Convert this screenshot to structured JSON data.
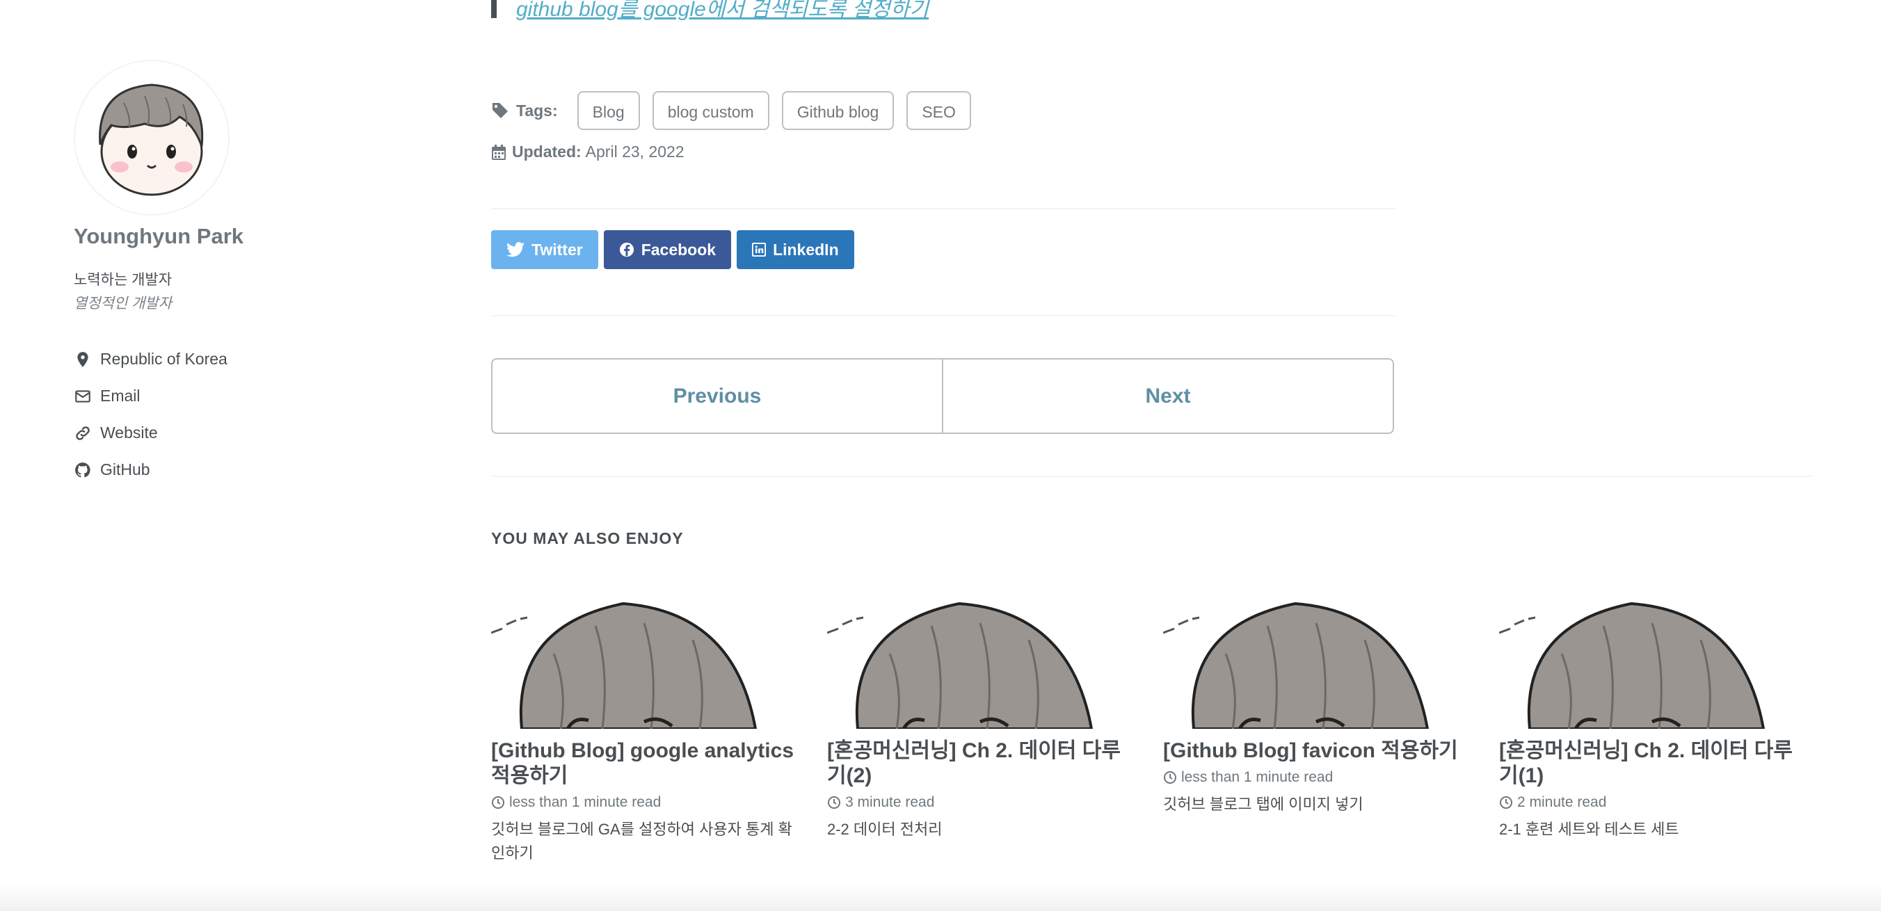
{
  "quote": {
    "link_text": "github blog를 google에서 검색되도록 설정하기"
  },
  "sidebar": {
    "author_name": "Younghyun Park",
    "bio_line1": "노력하는 개발자",
    "bio_line2": "열정적인 개발자",
    "links": [
      {
        "label": "Republic of Korea",
        "icon": "map-marker-icon"
      },
      {
        "label": "Email",
        "icon": "envelope-icon"
      },
      {
        "label": "Website",
        "icon": "link-icon"
      },
      {
        "label": "GitHub",
        "icon": "github-icon"
      }
    ]
  },
  "meta": {
    "tags_label": "Tags:",
    "tags": [
      "Blog",
      "blog custom",
      "Github blog",
      "SEO"
    ],
    "updated_label": "Updated:",
    "updated_value": "April 23, 2022"
  },
  "share": {
    "twitter": "Twitter",
    "facebook": "Facebook",
    "linkedin": "LinkedIn",
    "colors": {
      "twitter": "#6bb3ee",
      "facebook": "#3b5998",
      "linkedin": "#2a76b9"
    }
  },
  "pager": {
    "previous": "Previous",
    "next": "Next"
  },
  "related": {
    "title": "YOU MAY ALSO ENJOY",
    "posts": [
      {
        "title": "[Github Blog] google analytics 적용하기",
        "read_time": "less than 1 minute read",
        "excerpt": "깃허브 블로그에 GA를 설정하여 사용자 통계 확인하기"
      },
      {
        "title": "[혼공머신러닝] Ch 2. 데이터 다루기(2)",
        "read_time": "3 minute read",
        "excerpt": "2-2 데이터 전처리"
      },
      {
        "title": "[Github Blog] favicon 적용하기",
        "read_time": "less than 1 minute read",
        "excerpt": "깃허브 블로그 탭에 이미지 넣기"
      },
      {
        "title": "[혼공머신러닝] Ch 2. 데이터 다루기(1)",
        "read_time": "2 minute read",
        "excerpt": "2-1 훈련 세트와 테스트 세트"
      }
    ]
  },
  "accent_color": "#52adc8"
}
